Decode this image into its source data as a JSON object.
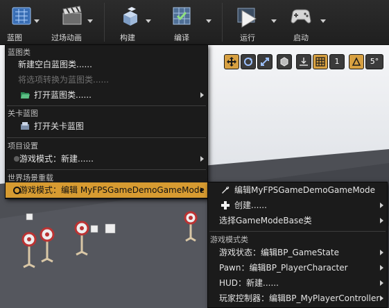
{
  "toolbar": {
    "blueprints": "蓝图",
    "cinematics": "过场动画",
    "build": "构建",
    "compile": "编译",
    "play": "运行",
    "launch": "启动"
  },
  "viewport_toolbar": {
    "snap_value": "1",
    "angle_value": "5°"
  },
  "blueprints_menu": {
    "sections": {
      "blueprint_class": "蓝图类",
      "level_blueprint": "关卡蓝图",
      "project_settings": "项目设置",
      "world_override": "世界场景重载"
    },
    "items": {
      "new_empty_blueprint": "新建空白蓝图类......",
      "convert_to_blueprint": "将选项转换为蓝图类......",
      "open_blueprint": "打开蓝图类......",
      "open_level_blueprint": "打开关卡蓝图",
      "game_mode_new": "游戏模式：新建......",
      "game_mode_edit": "游戏模式：编辑 MyFPSGameDemoGameMode"
    }
  },
  "gamemode_submenu": {
    "edit_item": "编辑MyFPSGameDemoGameMode",
    "create_item": "创建......",
    "select_base": "选择GameModeBase类",
    "section_classes": "游戏模式类",
    "game_state": "游戏状态：编辑BP_GameState",
    "pawn": "Pawn：编辑BP_PlayerCharacter",
    "hud": "HUD：新建......",
    "player_controller": "玩家控制器：编辑BP_MyPlayerController"
  },
  "colors": {
    "highlight": "#d79b31",
    "menu_bg": "#1b1b1b"
  }
}
